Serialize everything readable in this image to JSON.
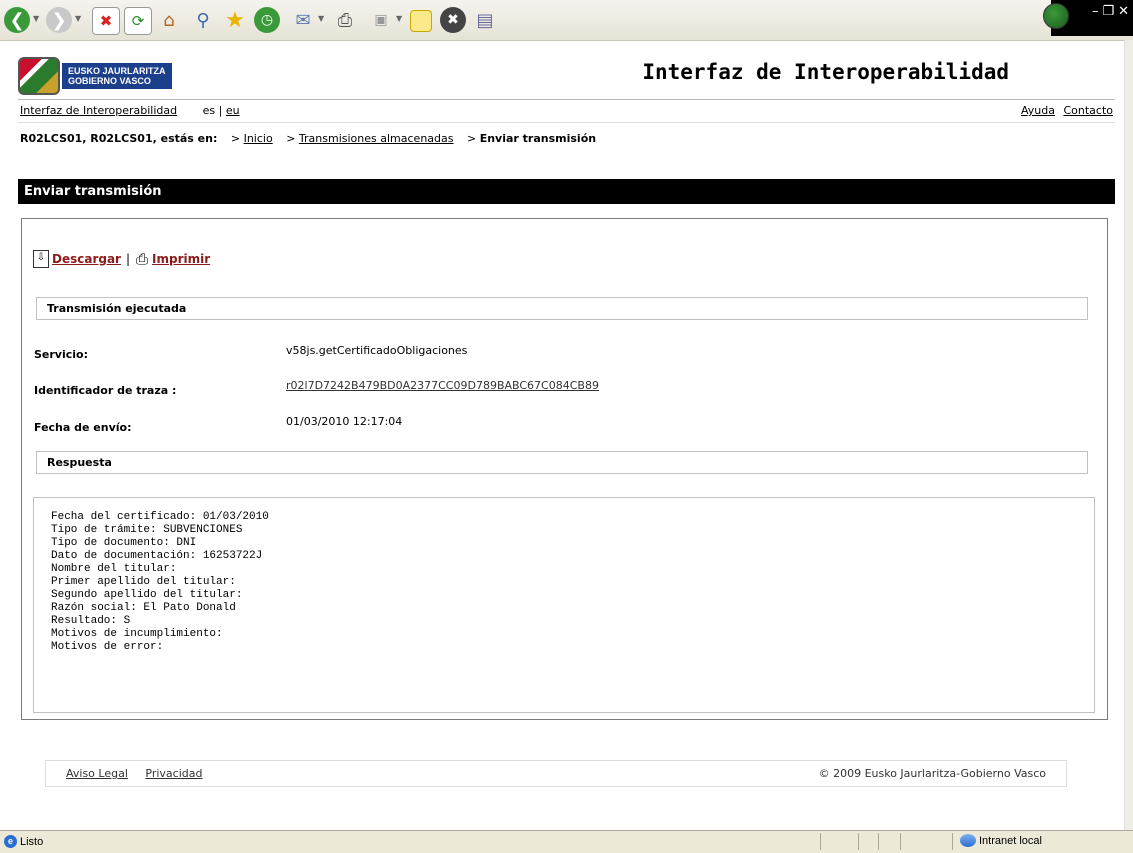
{
  "browser": {
    "toolbar_icons": [
      "back-icon",
      "forward-icon",
      "stop-icon",
      "refresh-icon",
      "home-icon",
      "search-icon",
      "favorites-icon",
      "history-icon",
      "mail-icon",
      "print-icon",
      "edit-icon",
      "notes-icon",
      "messenger-icon",
      "research-icon"
    ]
  },
  "header": {
    "logo_line1": "EUSKO JAURLARITZA",
    "logo_line2": "GOBIERNO VASCO",
    "title": "Interfaz de Interoperabilidad"
  },
  "topnav": {
    "home_link": "Interfaz de Interoperabilidad",
    "lang_es": "es",
    "lang_sep": "|",
    "lang_eu": "eu",
    "help": "Ayuda",
    "contact": "Contacto"
  },
  "breadcrumb": {
    "user": "R02LCS01, R02LCS01, estás en:",
    "items": [
      {
        "prefix": ">",
        "label": "Inicio"
      },
      {
        "prefix": ">",
        "label": "Transmisiones almacenadas"
      },
      {
        "prefix": ">",
        "label": "Enviar transmisión"
      }
    ]
  },
  "page": {
    "bar_title": "Enviar transmisión",
    "download": "Descargar",
    "actions_sep": "|",
    "print": "Imprimir",
    "section_executed": "Transmisión ejecutada",
    "service_label": "Servicio:",
    "service_value": "v58js.getCertificadoObligaciones",
    "trace_label": "Identificador de traza :",
    "trace_value": "r02l7D7242B479BD0A2377CC09D789BABC67C084CB89",
    "date_label": "Fecha de envío:",
    "date_value": "01/03/2010 12:17:04",
    "section_response": "Respuesta",
    "response_lines": [
      "Fecha del certificado: 01/03/2010",
      "Tipo de trámite: SUBVENCIONES",
      "Tipo de documento: DNI",
      "Dato de documentación: 16253722J",
      "Nombre del titular:",
      "Primer apellido del titular:",
      "Segundo apellido del titular:",
      "Razón social: El Pato Donald",
      "Resultado: S",
      "Motivos de incumplimiento:",
      "Motivos de error:"
    ]
  },
  "footer": {
    "legal": "Aviso Legal",
    "privacy": "Privacidad",
    "copyright": "© 2009 Eusko Jaurlaritza-Gobierno Vasco"
  },
  "statusbar": {
    "status": "Listo",
    "zone": "Intranet local"
  }
}
